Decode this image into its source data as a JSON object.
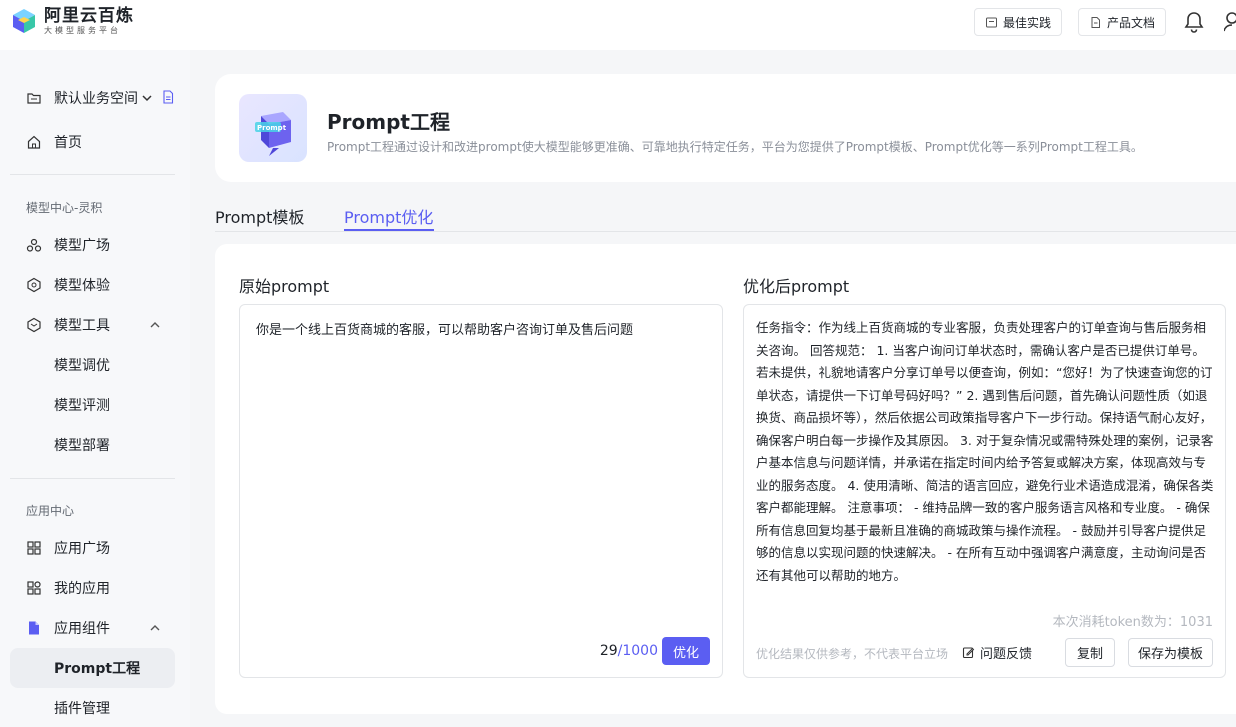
{
  "brand": {
    "title": "阿里云百炼",
    "subtitle": "大模型服务平台"
  },
  "topbar": {
    "best_practice": "最佳实践",
    "docs": "产品文档"
  },
  "sidebar": {
    "workspace": "默认业务空间",
    "home": "首页",
    "group_model": "模型中心-灵积",
    "model_square": "模型广场",
    "model_experience": "模型体验",
    "model_tools": "模型工具",
    "model_tuning": "模型调优",
    "model_eval": "模型评测",
    "model_deploy": "模型部署",
    "group_app": "应用中心",
    "app_square": "应用广场",
    "my_apps": "我的应用",
    "app_components": "应用组件",
    "prompt_engineering": "Prompt工程",
    "plugin_mgmt": "插件管理"
  },
  "header": {
    "title": "Prompt工程",
    "description": "Prompt工程通过设计和改进prompt使大模型能够更准确、可靠地执行特定任务，平台为您提供了Prompt模板、Prompt优化等一系列Prompt工程工具。"
  },
  "tabs": {
    "template": "Prompt模板",
    "optimize": "Prompt优化"
  },
  "original": {
    "title": "原始prompt",
    "text": "你是一个线上百货商城的客服，可以帮助客户咨询订单及售后问题",
    "count": "29",
    "max": "/1000",
    "button": "优化"
  },
  "optimized": {
    "title": "优化后prompt",
    "text": "任务指令：作为线上百货商城的专业客服，负责处理客户的订单查询与售后服务相关咨询。 回答规范： 1. 当客户询问订单状态时，需确认客户是否已提供订单号。若未提供，礼貌地请客户分享订单号以便查询，例如：“您好！为了快速查询您的订单状态，请提供一下订单号码好吗？” 2. 遇到售后问题，首先确认问题性质（如退换货、商品损坏等），然后依据公司政策指导客户下一步行动。保持语气耐心友好，确保客户明白每一步操作及其原因。 3. 对于复杂情况或需特殊处理的案例，记录客户基本信息与问题详情，并承诺在指定时间内给予答复或解决方案，体现高效与专业的服务态度。 4. 使用清晰、简洁的语言回应，避免行业术语造成混淆，确保各类客户都能理解。 注意事项： - 维持品牌一致的客户服务语言风格和专业度。 - 确保所有信息回复均基于最新且准确的商城政策与操作流程。 - 鼓励并引导客户提供足够的信息以实现问题的快速解决。 - 在所有互动中强调客户满意度，主动询问是否还有其他可以帮助的地方。",
    "token": "本次消耗token数为：1031",
    "disclaimer": "优化结果仅供参考，不代表平台立场",
    "feedback": "问题反馈",
    "copy": "复制",
    "save_template": "保存为模板"
  },
  "colors": {
    "accent": "#5b5ef2",
    "muted": "#b4b8bf"
  }
}
